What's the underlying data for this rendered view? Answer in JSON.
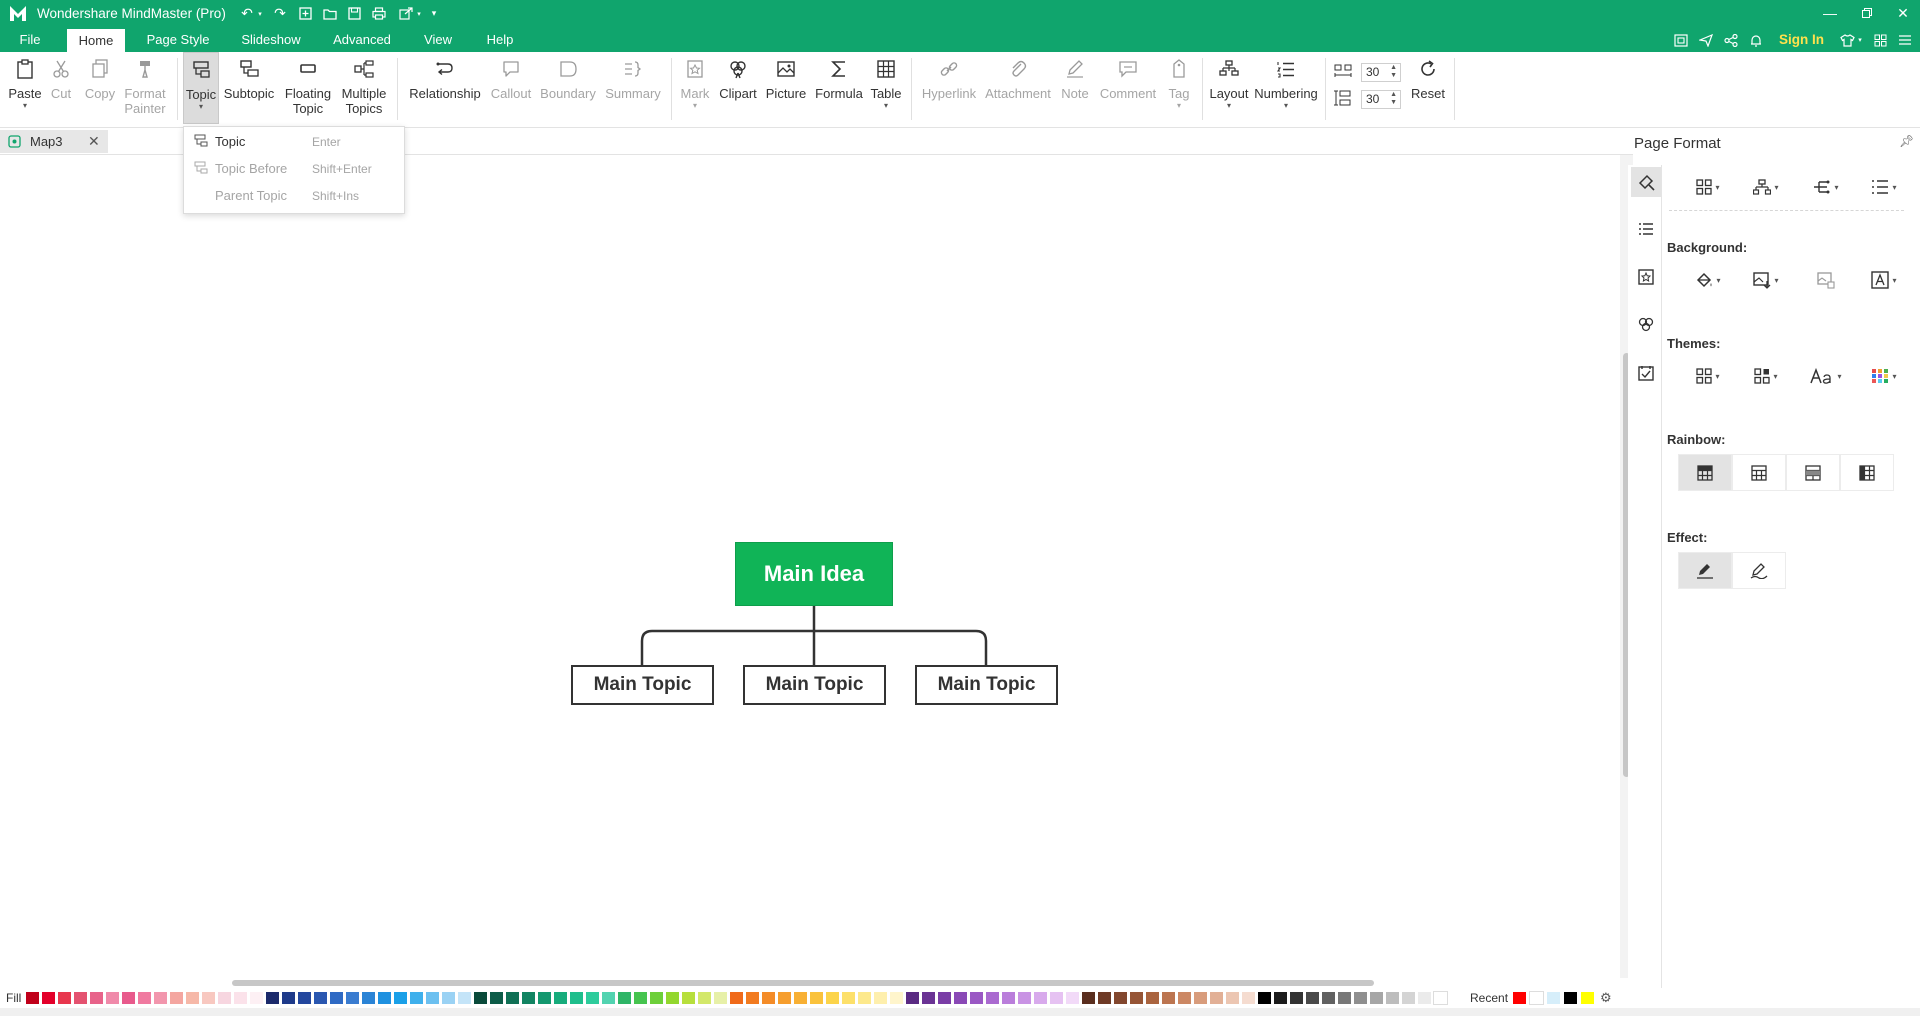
{
  "app": {
    "title": "Wondershare MindMaster (Pro)",
    "sign_in": "Sign In"
  },
  "menu": [
    {
      "label": "File"
    },
    {
      "label": "Home"
    },
    {
      "label": "Page Style"
    },
    {
      "label": "Slideshow"
    },
    {
      "label": "Advanced"
    },
    {
      "label": "View"
    },
    {
      "label": "Help"
    }
  ],
  "ribbon": {
    "paste": "Paste",
    "cut": "Cut",
    "copy": "Copy",
    "format_painter": "Format\nPainter",
    "topic": "Topic",
    "subtopic": "Subtopic",
    "floating_topic": "Floating\nTopic",
    "multiple_topics": "Multiple\nTopics",
    "relationship": "Relationship",
    "callout": "Callout",
    "boundary": "Boundary",
    "summary": "Summary",
    "mark": "Mark",
    "clipart": "Clipart",
    "picture": "Picture",
    "formula": "Formula",
    "table": "Table",
    "hyperlink": "Hyperlink",
    "attachment": "Attachment",
    "note": "Note",
    "comment": "Comment",
    "tag": "Tag",
    "layout": "Layout",
    "numbering": "Numbering",
    "spacing_h": "30",
    "spacing_v": "30",
    "reset": "Reset"
  },
  "tabs": [
    {
      "label": "Map3"
    }
  ],
  "topic_dropdown": [
    {
      "label": "Topic",
      "shortcut": "Enter",
      "enabled": true
    },
    {
      "label": "Topic Before",
      "shortcut": "Shift+Enter",
      "enabled": false
    },
    {
      "label": "Parent Topic",
      "shortcut": "Shift+Ins",
      "enabled": false
    }
  ],
  "mindmap": {
    "central": "Main Idea",
    "topics": [
      "Main Topic",
      "Main Topic",
      "Main Topic"
    ],
    "central_color": "#10b457"
  },
  "panel": {
    "title": "Page Format",
    "background_label": "Background:",
    "themes_label": "Themes:",
    "rainbow_label": "Rainbow:",
    "effect_label": "Effect:"
  },
  "colorbar": {
    "fill_label": "Fill",
    "recent_label": "Recent",
    "swatches": [
      "#c0001a",
      "#e3002a",
      "#e8374e",
      "#e45270",
      "#e8638a",
      "#f08aaa",
      "#e85a8c",
      "#f07aa0",
      "#f296ad",
      "#f4a6a0",
      "#f6b8a8",
      "#f8c8c0",
      "#f7d6e0",
      "#fbe2ea",
      "#fdf0f4",
      "#1c2a6b",
      "#1e3a8a",
      "#24479e",
      "#2a57b0",
      "#2f6ac4",
      "#3a7cd0",
      "#2b84d6",
      "#1f91e0",
      "#1aa0e8",
      "#3fb0ec",
      "#6cc0f0",
      "#9ad2f4",
      "#c4e4f8",
      "#0a4a3a",
      "#0d5c48",
      "#107055",
      "#128462",
      "#14986f",
      "#17ac7c",
      "#1fbe8c",
      "#2ecc9c",
      "#52d3b0",
      "#2fb567",
      "#46c44f",
      "#6dcf3a",
      "#93d72e",
      "#b7df3c",
      "#d3e86a",
      "#e7f0a8",
      "#f06a1a",
      "#f27b20",
      "#f48c28",
      "#f69e2e",
      "#f8b034",
      "#fac23c",
      "#fcd44a",
      "#fde06a",
      "#fde98c",
      "#feefad",
      "#fff5cc",
      "#5a2a82",
      "#6a3394",
      "#7a3da6",
      "#8a49b6",
      "#9a58c4",
      "#aa6ad0",
      "#ba7edb",
      "#c993e4",
      "#d8aaec",
      "#e6c2f2",
      "#f2daf8",
      "#5a2e1e",
      "#6e3a26",
      "#82472e",
      "#965536",
      "#aa643f",
      "#bc7550",
      "#cc8864",
      "#d89c7c",
      "#e2b096",
      "#ecc6b2",
      "#f5dcd0",
      "#000000",
      "#1c1c1c",
      "#333333",
      "#4a4a4a",
      "#616161",
      "#787878",
      "#8f8f8f",
      "#a6a6a6",
      "#bdbdbd",
      "#d4d4d4",
      "#ebebeb",
      "#ffffff"
    ],
    "recent": [
      "#ff0000",
      "#ffffff",
      "#d6eefa",
      "#000000",
      "#ffff00"
    ]
  }
}
